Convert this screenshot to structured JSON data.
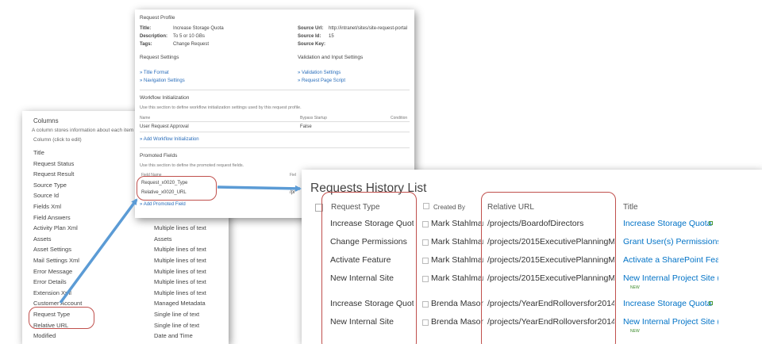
{
  "columns_panel": {
    "title": "Columns",
    "description": "A column stores information about each item in",
    "header": "Column (click to edit)",
    "rows": [
      {
        "name": "Title",
        "type": ""
      },
      {
        "name": "Request Status",
        "type": ""
      },
      {
        "name": "Request Result",
        "type": ""
      },
      {
        "name": "Source Type",
        "type": ""
      },
      {
        "name": "Source Id",
        "type": ""
      },
      {
        "name": "Fields Xml",
        "type": ""
      },
      {
        "name": "Field Answers",
        "type": ""
      },
      {
        "name": "Activity Plan Xml",
        "type": "Multiple lines of text"
      },
      {
        "name": "Assets",
        "type": "Assets"
      },
      {
        "name": "Asset Settings",
        "type": "Multiple lines of text"
      },
      {
        "name": "Mail Settings Xml",
        "type": "Multiple lines of text"
      },
      {
        "name": "Error Message",
        "type": "Multiple lines of text"
      },
      {
        "name": "Error Details",
        "type": "Multiple lines of text"
      },
      {
        "name": "Extension Xml",
        "type": "Multiple lines of text"
      },
      {
        "name": "Customer Account",
        "type": "Managed Metadata"
      },
      {
        "name": "Request Type",
        "type": "Single line of text"
      },
      {
        "name": "Relative URL",
        "type": "Single line of text"
      },
      {
        "name": "Modified",
        "type": "Date and Time"
      }
    ]
  },
  "profile_panel": {
    "heading": "Request Profile",
    "title_label": "Title:",
    "title_value": "Increase Storage Quota",
    "description_label": "Description:",
    "description_value": "To 5 or 10 GBs",
    "tags_label": "Tags:",
    "tags_value": "Change Request",
    "source_url_label": "Source Url:",
    "source_url_value": "http://intranet/sites/site-request-portal",
    "source_id_label": "Source Id:",
    "source_id_value": "15",
    "source_key_label": "Source Key:",
    "request_settings": "Request Settings",
    "validation_settings": "Validation and Input Settings",
    "link_title_format": "Title Format",
    "link_navigation_settings": "Navigation Settings",
    "link_validation_settings": "Validation Settings",
    "link_request_page_script": "Request Page Script",
    "workflow_heading": "Workflow Initialization",
    "workflow_note": "Use this section to define workflow initialization settings used by this request profile.",
    "wf_col_name": "Name",
    "wf_col_bypass": "Bypass Startup",
    "wf_col_condition": "Condition",
    "wf_row_name": "User Request Approval",
    "wf_row_bypass": "False",
    "add_workflow": "Add Workflow Initialization",
    "promoted_heading": "Promoted Fields",
    "promoted_note": "Use this section to define the promoted request fields.",
    "pf_col_field": "Field Name",
    "pf_col_field2": "Fiel",
    "promoted_fields": [
      "Request_x0020_Type",
      "Relative_x0020_URL"
    ],
    "promoted_trail": "/pr",
    "add_promoted": "Add Promoted Field"
  },
  "history": {
    "title": "Requests History List",
    "columns": {
      "request_type": "Request Type",
      "created_by": "Created By",
      "relative_url": "Relative URL",
      "title": "Title"
    },
    "new_badge": "NEW",
    "rows": [
      {
        "type": "Increase Storage Quota",
        "created_by": "Mark Stahlman",
        "url": "/projects/BoardofDirectors",
        "title": "Increase Storage Quota"
      },
      {
        "type": "Change Permissions",
        "created_by": "Mark Stahlman",
        "url": "/projects/2015ExecutivePlanningMtg",
        "title": "Grant User(s) Permissions"
      },
      {
        "type": "Activate Feature",
        "created_by": "Mark Stahlman",
        "url": "/projects/2015ExecutivePlanningMtg",
        "title": "Activate a SharePoint Featu"
      },
      {
        "type": "New Internal Site",
        "created_by": "Mark Stahlman",
        "url": "/projects/2015ExecutivePlanningMtg",
        "title": "New Internal Project Site (2"
      },
      {
        "type": "Increase Storage Quota",
        "created_by": "Brenda Mason",
        "url": "/projects/YearEndRolloversfor2014",
        "title": "Increase Storage Quota"
      },
      {
        "type": "New Internal Site",
        "created_by": "Brenda Mason",
        "url": "/projects/YearEndRolloversfor2014",
        "title": "New Internal Project Site (Y"
      }
    ]
  }
}
